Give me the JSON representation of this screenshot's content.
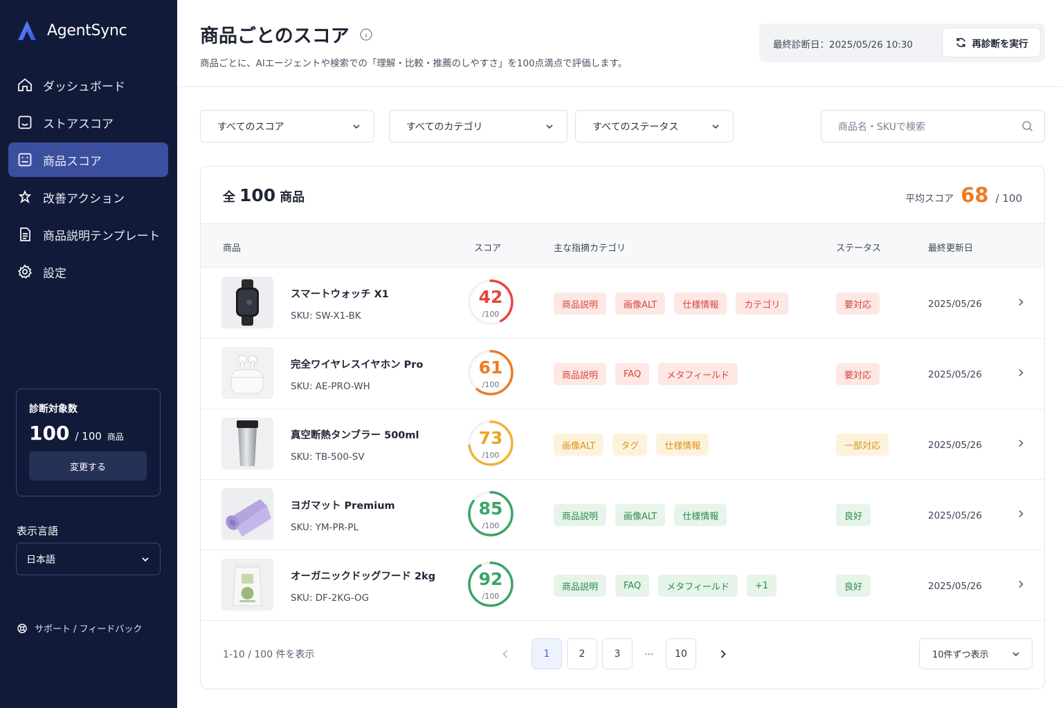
{
  "app": {
    "name": "AgentSync"
  },
  "sidebar": {
    "items": [
      {
        "label": "ダッシュボード",
        "icon": "home-icon"
      },
      {
        "label": "ストアスコア",
        "icon": "store-score-icon"
      },
      {
        "label": "商品スコア",
        "icon": "product-score-icon",
        "active": true
      },
      {
        "label": "改善アクション",
        "icon": "improvement-icon"
      },
      {
        "label": "商品説明テンプレート",
        "icon": "template-icon"
      },
      {
        "label": "設定",
        "icon": "gear-icon"
      }
    ],
    "card": {
      "title": "診断対象数",
      "count": "100",
      "of": "/ 100",
      "unit": "商品",
      "button": "変更する"
    },
    "language_label": "表示言語",
    "language_value": "日本語",
    "support": "サポート / フィードバック"
  },
  "header": {
    "title": "商品ごとのスコア",
    "subtitle": "商品ごとに、AIエージェントや検索での「理解・比較・推薦のしやすさ」を100点満点で評価します。",
    "last_diagnosis": "最終診断日：2025/05/26 10:30",
    "rerun_label": "再診断を実行"
  },
  "filters": {
    "score": "すべてのスコア",
    "category": "すべてのカテゴリ",
    "status": "すべてのステータス",
    "search_placeholder": "商品名・SKUで検索"
  },
  "summary": {
    "total_prefix": "全",
    "total_count": "100",
    "total_suffix": "商品",
    "avg_label": "平均スコア",
    "avg_value": "68",
    "avg_of": "/ 100"
  },
  "columns": {
    "product": "商品",
    "score": "スコア",
    "category": "主な指摘カテゴリ",
    "status": "ステータス",
    "updated": "最終更新日"
  },
  "rows": [
    {
      "name": "スマートウォッチ X1",
      "sku": "SKU: SW-X1-BK",
      "score": "42",
      "of": "/100",
      "tags": [
        "商品説明",
        "画像ALT",
        "仕様情報",
        "カテゴリ"
      ],
      "status": "要対応",
      "date": "2025/05/26"
    },
    {
      "name": "完全ワイヤレスイヤホン Pro",
      "sku": "SKU: AE-PRO-WH",
      "score": "61",
      "of": "/100",
      "tags": [
        "商品説明",
        "FAQ",
        "メタフィールド"
      ],
      "status": "要対応",
      "date": "2025/05/26"
    },
    {
      "name": "真空断熱タンブラー 500ml",
      "sku": "SKU: TB-500-SV",
      "score": "73",
      "of": "/100",
      "tags": [
        "画像ALT",
        "タグ",
        "仕様情報"
      ],
      "status": "一部対応",
      "date": "2025/05/26"
    },
    {
      "name": "ヨガマット Premium",
      "sku": "SKU: YM-PR-PL",
      "score": "85",
      "of": "/100",
      "tags": [
        "商品説明",
        "画像ALT",
        "仕様情報"
      ],
      "status": "良好",
      "date": "2025/05/26"
    },
    {
      "name": "オーガニックドッグフード 2kg",
      "sku": "SKU: DF-2KG-OG",
      "score": "92",
      "of": "/100",
      "tags": [
        "商品説明",
        "FAQ",
        "メタフィールド",
        "+1"
      ],
      "status": "良好",
      "date": "2025/05/26"
    }
  ],
  "pagination": {
    "info": "1-10 / 100 件を表示",
    "pages": [
      "1",
      "2",
      "3",
      "10"
    ],
    "ellipsis": "...",
    "current": "1",
    "per_page": "10件ずつ表示"
  },
  "colors": {
    "sidebar": "#111a38",
    "active": "#3b4f9e",
    "accent_orange": "#ef7a23",
    "red": "#e5473c",
    "orange": "#ef7a23",
    "yellow": "#f2b232",
    "green": "#3aa566"
  }
}
